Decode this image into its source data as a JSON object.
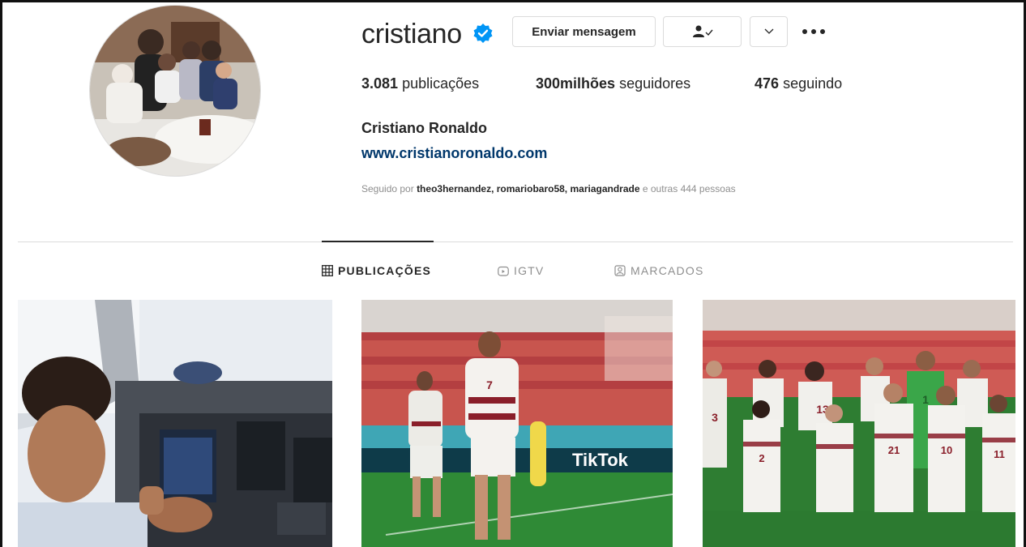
{
  "profile": {
    "username": "cristiano",
    "buttons": {
      "message": "Enviar mensagem"
    },
    "stats": {
      "posts_count": "3.081",
      "posts_label": "publicações",
      "followers_count": "300milhões",
      "followers_label": "seguidores",
      "following_count": "476",
      "following_label": "seguindo"
    },
    "full_name": "Cristiano Ronaldo",
    "website": "www.cristianoronaldo.com",
    "followed_by": {
      "prefix": "Seguido por",
      "users": [
        "theo3hernandez",
        "romariobaro58",
        "mariagandrade"
      ],
      "suffix": "e outras 444 pessoas"
    }
  },
  "tabs": [
    {
      "label": "PUBLICAÇÕES",
      "icon": "grid-icon",
      "active": true
    },
    {
      "label": "IGTV",
      "icon": "igtv-icon",
      "active": false
    },
    {
      "label": "MARCADOS",
      "icon": "tagged-icon",
      "active": false
    }
  ],
  "posts": [
    {
      "id": "post-cockpit"
    },
    {
      "id": "post-celebration",
      "overlay_text": "TikTok",
      "jersey_number": "7"
    },
    {
      "id": "post-team-photo",
      "jersey_numbers": [
        "3",
        "13",
        "1",
        "2",
        "21",
        "10",
        "11"
      ]
    }
  ],
  "colors": {
    "text": "#262626",
    "muted": "#8e8e8e",
    "link": "#00376b",
    "verified": "#0095f6",
    "border": "#dbdbdb"
  }
}
